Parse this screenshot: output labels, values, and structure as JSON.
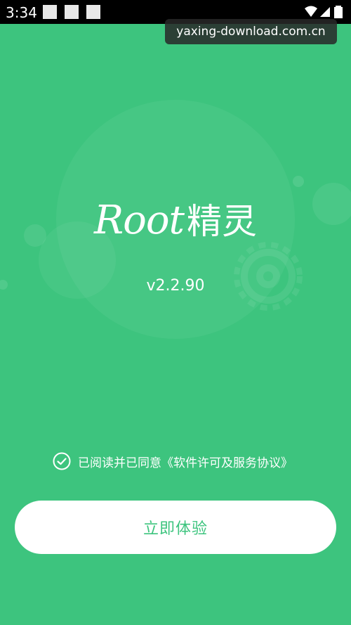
{
  "status": {
    "time": "3:34",
    "icons": [
      "notification-square-icon",
      "notification-square-icon",
      "notification-square-icon",
      "wifi-icon",
      "signal-icon",
      "battery-icon"
    ]
  },
  "watermark": "yaxing-download.com.cn",
  "app": {
    "name_latin": "Root",
    "name_cn": "精灵",
    "version": "v2.2.90"
  },
  "agreement": {
    "checked": true,
    "text": "已阅读并已同意《软件许可及服务协议》"
  },
  "cta_label": "立即体验",
  "colors": {
    "background": "#3dc47e",
    "button_bg": "#ffffff",
    "button_text": "#3dc47e",
    "status_bar": "#000000"
  }
}
